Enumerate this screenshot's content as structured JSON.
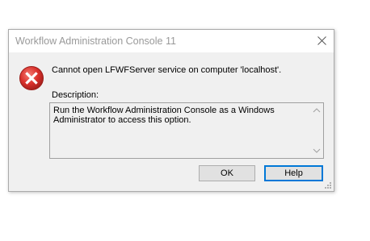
{
  "dialog": {
    "title": "Workflow Administration Console 11",
    "message": "Cannot open LFWFServer service on computer 'localhost'.",
    "description_label": "Description:",
    "description_text": "Run the Workflow Administration Console as a Windows Administrator to access this option.",
    "buttons": {
      "ok_label": "OK",
      "help_label": "Help"
    },
    "icons": {
      "error": "error-icon",
      "close": "close-icon",
      "scroll_up": "scroll-up-arrow-icon",
      "scroll_down": "scroll-down-arrow-icon",
      "resize": "resize-grip-icon"
    },
    "colors": {
      "error_red": "#d9302b",
      "focus_blue": "#0078d7",
      "dialog_bg": "#f0f0f0"
    }
  }
}
